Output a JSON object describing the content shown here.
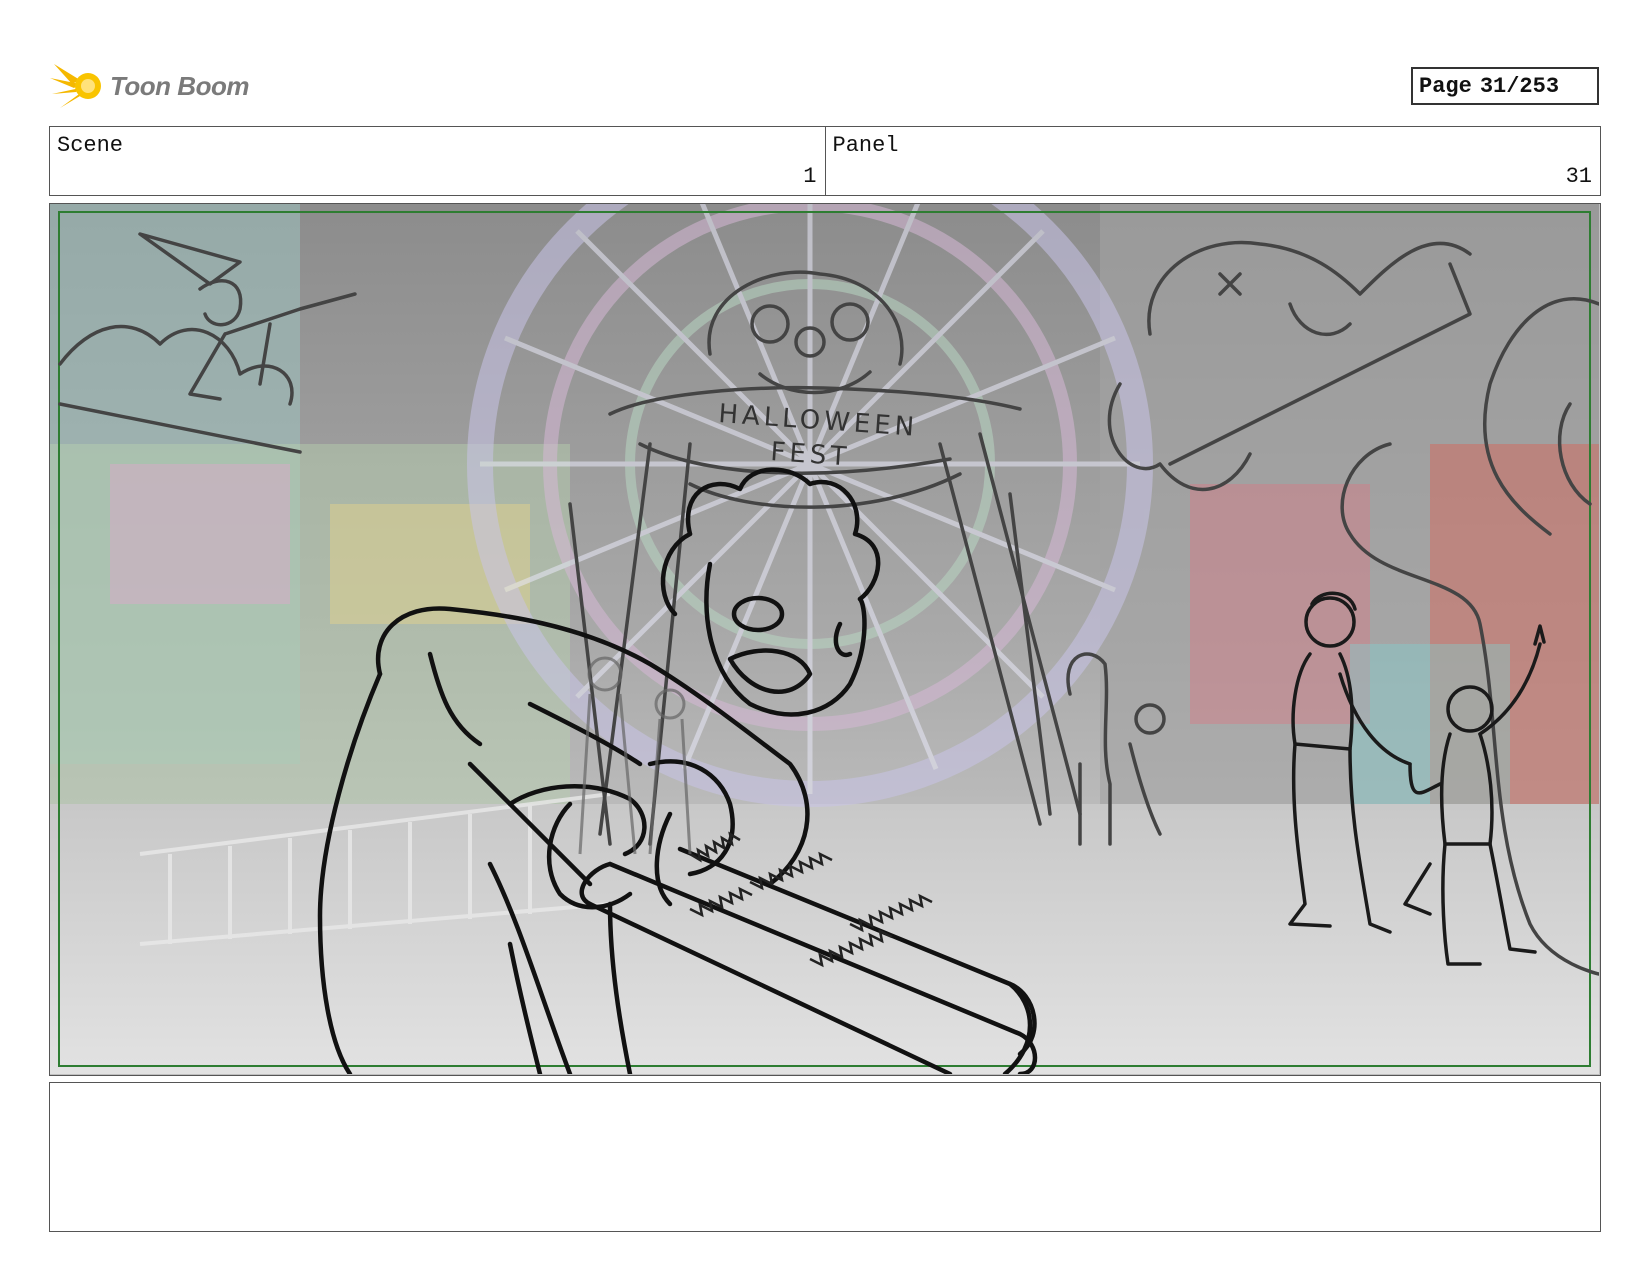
{
  "logo": {
    "text": "Toon Boom",
    "icon": "starburst-logo-icon",
    "color": "#f5b800"
  },
  "page": {
    "label": "Page",
    "number": "31/253"
  },
  "scene": {
    "label": "Scene",
    "value": "1"
  },
  "panel": {
    "label": "Panel",
    "value": "31"
  },
  "artwork": {
    "banner_line1": "HALLOWEEN",
    "banner_line2": "FEST",
    "safe_area_color": "#2e7d32"
  },
  "caption": {
    "text": ""
  }
}
